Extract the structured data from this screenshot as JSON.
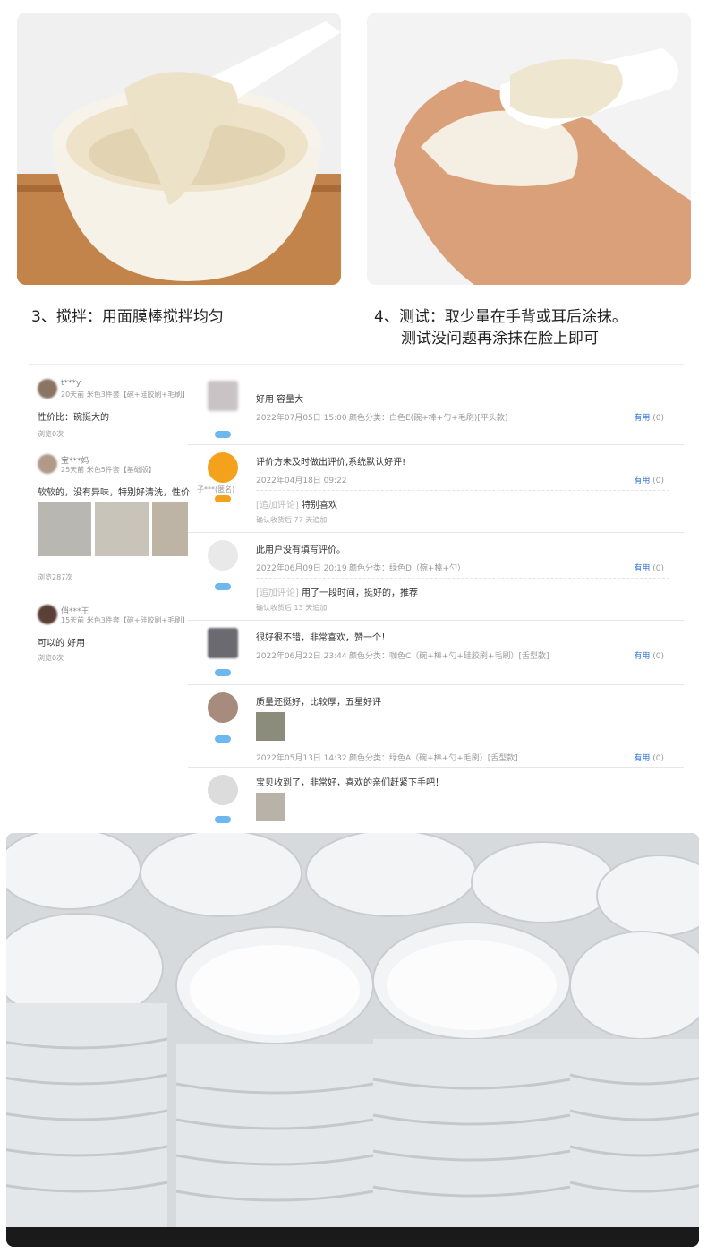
{
  "steps": {
    "step3": "3、搅拌：用面膜棒搅拌均匀",
    "step4_line1": "4、测试：取少量在手背或耳后涂抹。",
    "step4_line2": "测试没问题再涂抹在脸上即可"
  },
  "sidebar_reviews": [
    {
      "name": "t***y",
      "meta": "20天前  米色3件套【碗+硅胶刷+毛刷】",
      "text": "性价比：碗挺大的",
      "views": "浏览0次"
    },
    {
      "name": "宝***妈",
      "meta": "25天前  米色5件套【基础版】",
      "text": "软软的，没有异味，特别好清洗，性价",
      "views": "浏览287次"
    },
    {
      "name": "俏***王",
      "meta": "15天前  米色3件套【碗+硅胶刷+毛刷】",
      "text": "可以的 好用",
      "views": "浏览0次"
    }
  ],
  "reviews": [
    {
      "text": "好用 容量大",
      "date": "2022年07月05日 15:00",
      "color": "颜色分类：白色E(碗+棒+勺+毛刷)[平头款]",
      "useful": "有用",
      "count": "(0)",
      "level": "3"
    },
    {
      "text": "评价方未及时做出评价,系统默认好评!",
      "date": "2022年04月18日 09:22",
      "color": "",
      "useful": "有用",
      "count": "(0)",
      "user": "子***(匿名)",
      "add_tag": "[追加评论]",
      "add_text": "特别喜欢",
      "add_meta": "确认收货后 77 天追加",
      "level": "1"
    },
    {
      "text": "此用户没有填写评价。",
      "date": "2022年06月09日 20:19",
      "color": "颜色分类：绿色D（碗+棒+勺）",
      "useful": "有用",
      "count": "(0)",
      "add_tag": "[追加评论]",
      "add_text": "用了一段时间，挺好的，推荐",
      "add_meta": "确认收货后 13 天追加",
      "level": "3"
    },
    {
      "text": "很好很不错，非常喜欢，赞一个！",
      "date": "2022年06月22日 23:44",
      "color": "颜色分类：咖色C（碗+棒+勺+硅胶刷+毛刷）[舌型款]",
      "useful": "有用",
      "count": "(0)",
      "level": "4"
    },
    {
      "text": "质量还挺好，比较厚，五星好评",
      "date": "2022年05月13日 14:32",
      "color": "颜色分类：绿色A（碗+棒+勺+毛刷）[舌型款]",
      "useful": "有用",
      "count": "(0)",
      "level": "2"
    },
    {
      "text": "宝贝收到了，非常好，喜欢的亲们赶紧下手吧！",
      "date": "",
      "color": "",
      "useful": "",
      "count": "",
      "level": "3"
    }
  ],
  "colors": {
    "link": "#2a6fd6",
    "vip": "#6fb7ef"
  }
}
